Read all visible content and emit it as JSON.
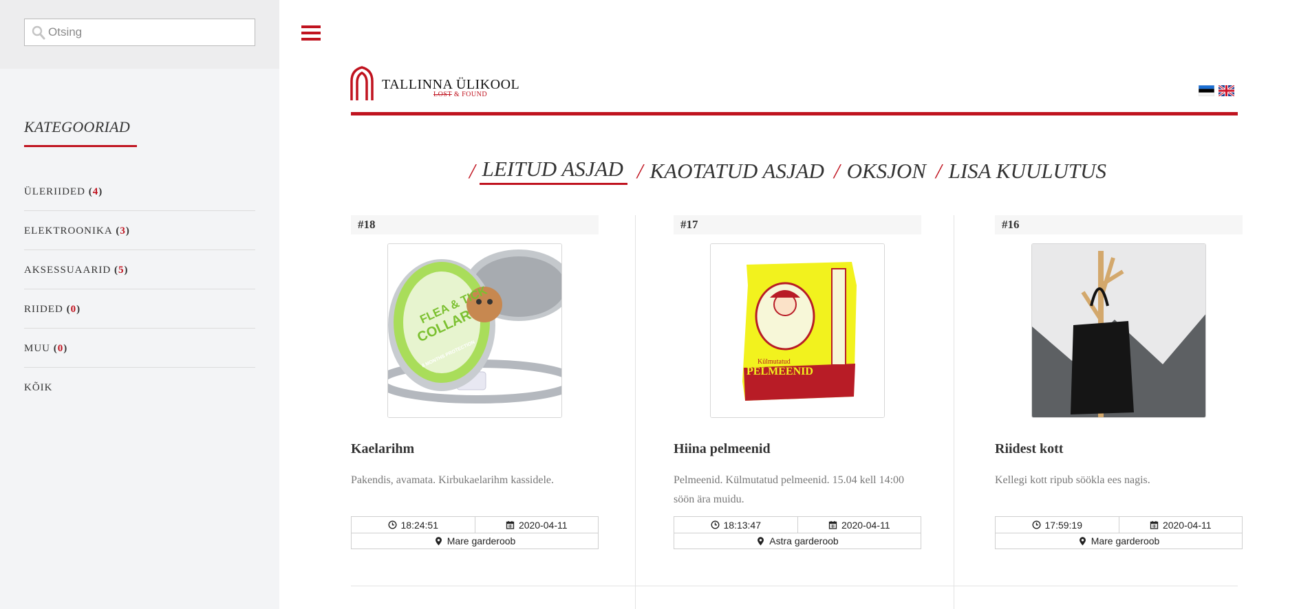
{
  "search": {
    "placeholder": "Otsing"
  },
  "sidebar": {
    "title": "KATEGOORIAD",
    "categories": [
      {
        "label": "ÜLERIIDED",
        "count": "4"
      },
      {
        "label": "ELEKTROONIKA",
        "count": "3"
      },
      {
        "label": "AKSESSUAARID",
        "count": "5"
      },
      {
        "label": "RIIDED",
        "count": "0"
      },
      {
        "label": "MUU",
        "count": "0"
      },
      {
        "label": "KÕIK"
      }
    ]
  },
  "header": {
    "logo_text": "TALLINNA ÜLIKOOL",
    "logo_sub_lost": "LOST",
    "logo_sub_found": "& FOUND"
  },
  "tabs": [
    {
      "label": "LEITUD ASJAD",
      "active": true
    },
    {
      "label": "KAOTATUD ASJAD"
    },
    {
      "label": "OKSJON"
    },
    {
      "label": "LISA KUULUTUS"
    }
  ],
  "colors": {
    "accent": "#c0131f",
    "sidebar_bg": "#f3f4f6"
  },
  "items": [
    {
      "number": "#18",
      "title": "Kaelarihm",
      "description": "Pakendis, avamata. Kirbukaelarihm kassidele.",
      "time": "18:24:51",
      "date": "2020-04-11",
      "location": "Mare garderoob"
    },
    {
      "number": "#17",
      "title": "Hiina pelmeenid",
      "description": "Pelmeenid. Külmutatud pelmeenid. 15.04 kell 14:00 söön ära muidu.",
      "time": "18:13:47",
      "date": "2020-04-11",
      "location": "Astra garderoob"
    },
    {
      "number": "#16",
      "title": "Riidest kott",
      "description": "Kellegi kott ripub söökla ees nagis.",
      "time": "17:59:19",
      "date": "2020-04-11",
      "location": "Mare garderoob"
    }
  ],
  "images": {
    "item_18": {
      "text_1": "FLEA & TICK",
      "text_2": "COLLAR",
      "text_3": "8 MONTHS PROTECTION"
    },
    "item_17": {
      "text_1": "Külmutatud",
      "text_2": "PELMEENID"
    }
  }
}
